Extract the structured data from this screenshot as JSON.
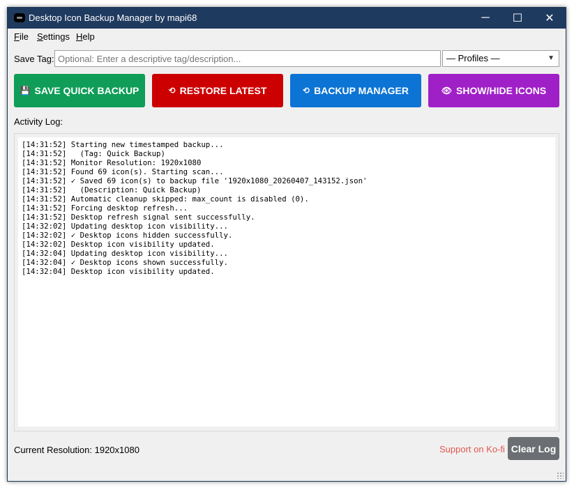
{
  "window": {
    "title": "Desktop Icon Backup Manager by mapi68"
  },
  "window_controls": {
    "minimize": "─",
    "maximize": "☐",
    "close": "✕"
  },
  "menu": [
    {
      "label": "File",
      "underline": "F",
      "rest": "ile"
    },
    {
      "label": "Settings",
      "underline": "S",
      "rest": "ettings"
    },
    {
      "label": "Help",
      "underline": "H",
      "rest": "elp"
    }
  ],
  "save_tag": {
    "label": "Save Tag:",
    "placeholder": "Optional: Enter a descriptive tag/description..."
  },
  "profiles": {
    "selected": "— Profiles —",
    "arrow_icon": "chevron-down-icon"
  },
  "buttons": {
    "save_quick_backup": {
      "label": "SAVE QUICK BACKUP",
      "icon": "💾",
      "color": "#0f9d58"
    },
    "restore_latest": {
      "label": "RESTORE LATEST",
      "icon": "⟲",
      "color": "#cc0000"
    },
    "backup_manager": {
      "label": "BACKUP MANAGER",
      "icon": "⟲",
      "color": "#0b74d4"
    },
    "show_hide_icons": {
      "label": "SHOW/HIDE ICONS",
      "icon": "👁",
      "color": "#a020c8"
    }
  },
  "activity_log": {
    "label": "Activity Log:",
    "lines": [
      "[14:31:52] Starting new timestamped backup...",
      "[14:31:52]   (Tag: Quick Backup)",
      "[14:31:52] Monitor Resolution: 1920x1080",
      "[14:31:52] Found 69 icon(s). Starting scan...",
      "[14:31:52] ✓ Saved 69 icon(s) to backup file '1920x1080_20260407_143152.json'",
      "[14:31:52]   (Description: Quick Backup)",
      "[14:31:52] Automatic cleanup skipped: max_count is disabled (0).",
      "[14:31:52] Forcing desktop refresh...",
      "[14:31:52] Desktop refresh signal sent successfully.",
      "[14:32:02] Updating desktop icon visibility...",
      "[14:32:02] ✓ Desktop icons hidden successfully.",
      "[14:32:02] Desktop icon visibility updated.",
      "[14:32:04] Updating desktop icon visibility...",
      "[14:32:04] ✓ Desktop icons shown successfully.",
      "[14:32:04] Desktop icon visibility updated."
    ]
  },
  "status": {
    "resolution_text": "Current Resolution: 1920x1080",
    "kofi_link": "Support on Ko-fi",
    "clear_button": "Clear Log"
  },
  "colors": {
    "titlebar": "#1f3a5f",
    "kofi": "#e0574d",
    "clear_button": "#6b6f73"
  }
}
